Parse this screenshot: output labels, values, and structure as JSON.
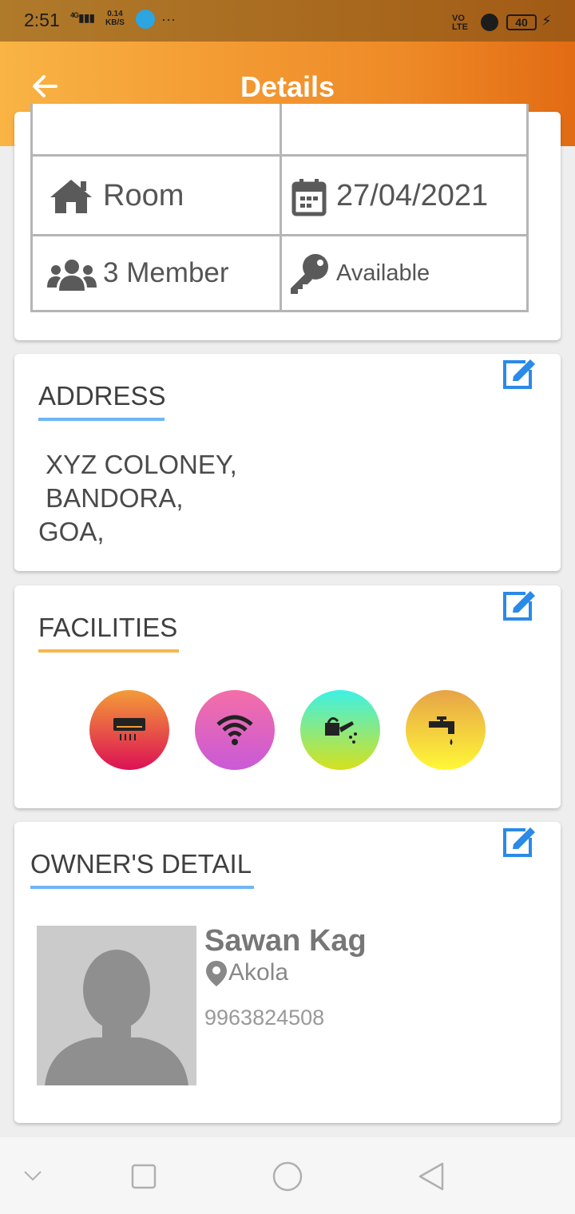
{
  "status_bar": {
    "time": "2:51",
    "signal": "4G",
    "speed_value": "0.14",
    "speed_unit": "KB/S",
    "overflow": "···",
    "volte": "VO LTE",
    "battery": "40"
  },
  "app_bar": {
    "title": "Details"
  },
  "room_info": {
    "type": "Room",
    "date": "27/04/2021",
    "members": "3 Member",
    "status": "Available"
  },
  "address": {
    "heading": "ADDRESS",
    "lines": " XYZ COLONEY,\n BANDORA,\nGOA,",
    "accent_color": "#6fb6f3"
  },
  "facilities": {
    "heading": "FACILITIES",
    "accent_color": "#f8b54d",
    "items": [
      {
        "icon": "air-conditioner-icon",
        "colors": [
          "#f39c38",
          "#dc1154"
        ]
      },
      {
        "icon": "wifi-icon",
        "colors": [
          "#f46ea6",
          "#c95ad8"
        ]
      },
      {
        "icon": "watering-can-icon",
        "colors": [
          "#3df1e6",
          "#d6e11c"
        ]
      },
      {
        "icon": "water-tap-icon",
        "colors": [
          "#e7a348",
          "#fff837"
        ]
      }
    ]
  },
  "owner": {
    "heading": "OWNER'S DETAIL",
    "accent_color": "#6fb6f3",
    "name": "Sawan Kag",
    "city": "Akola",
    "phone": "9963824508"
  },
  "colors": {
    "app_bar_start": "#f9b444",
    "app_bar_end": "#e26b13",
    "edit_icon": "#2a8ae8"
  }
}
